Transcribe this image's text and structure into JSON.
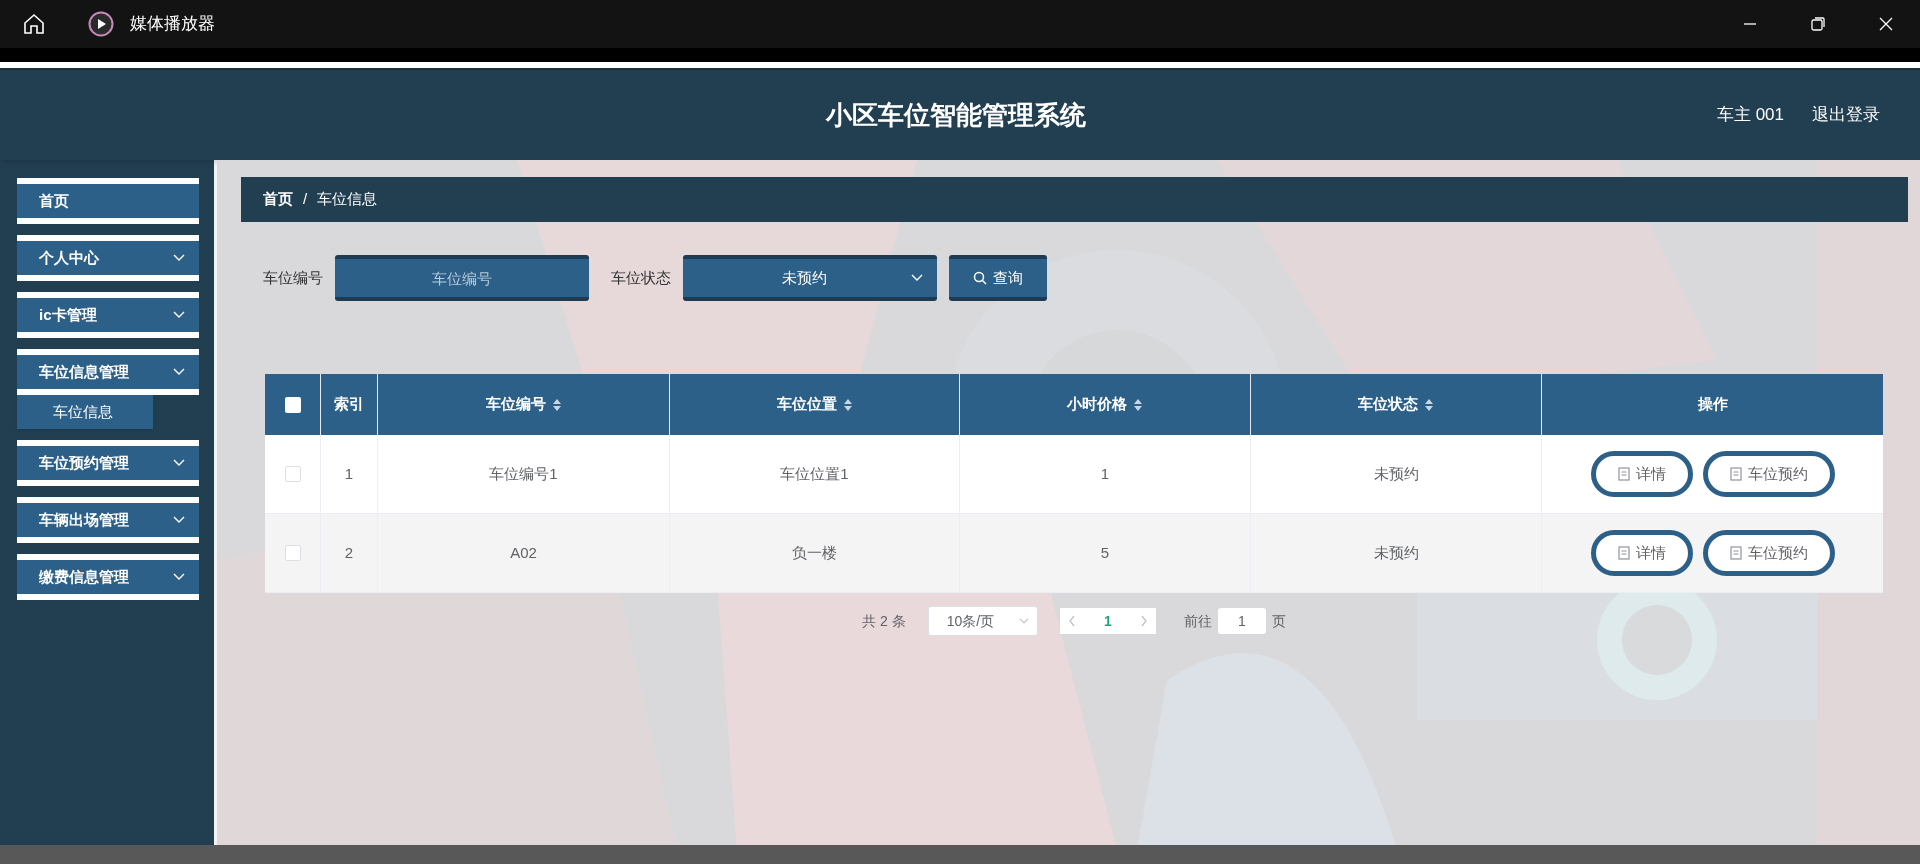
{
  "window": {
    "title": "媒体播放器"
  },
  "header": {
    "title": "小区车位智能管理系统",
    "user": "车主 001",
    "logout": "退出登录"
  },
  "sidebar": {
    "items": [
      {
        "label": "首页",
        "expandable": false
      },
      {
        "label": "个人中心",
        "expandable": true
      },
      {
        "label": "ic卡管理",
        "expandable": true
      },
      {
        "label": "车位信息管理",
        "expandable": true,
        "expanded": true,
        "children": [
          {
            "label": "车位信息"
          }
        ]
      },
      {
        "label": "车位预约管理",
        "expandable": true
      },
      {
        "label": "车辆出场管理",
        "expandable": true
      },
      {
        "label": "缴费信息管理",
        "expandable": true
      }
    ]
  },
  "breadcrumb": [
    "首页",
    "/",
    "车位信息"
  ],
  "search": {
    "fields": [
      {
        "label": "车位编号",
        "kind": "input",
        "placeholder": "车位编号"
      },
      {
        "label": "车位状态",
        "kind": "select",
        "value": "未预约"
      }
    ],
    "button": "查询"
  },
  "table": {
    "select_all": {
      "checked": false
    },
    "columns": [
      {
        "label": "索引",
        "sortable": false
      },
      {
        "label": "车位编号",
        "sortable": true
      },
      {
        "label": "车位位置",
        "sortable": true
      },
      {
        "label": "小时价格",
        "sortable": true
      },
      {
        "label": "车位状态",
        "sortable": true
      },
      {
        "label": "操作",
        "sortable": false
      }
    ],
    "rows": [
      {
        "checked": false,
        "cells": [
          "1",
          "车位编号1",
          "车位位置1",
          "1",
          "未预约"
        ],
        "actions": [
          "详情",
          "车位预约"
        ]
      },
      {
        "checked": false,
        "cells": [
          "2",
          "A02",
          "负一楼",
          "5",
          "未预约"
        ],
        "actions": [
          "详情",
          "车位预约"
        ]
      }
    ]
  },
  "pagination": {
    "total": "共 2 条",
    "page_size": "10条/页",
    "pages": [
      {
        "label": "1",
        "selected": true
      }
    ],
    "goto_label": "前往",
    "goto_value": "1",
    "goto_suffix": "页"
  }
}
